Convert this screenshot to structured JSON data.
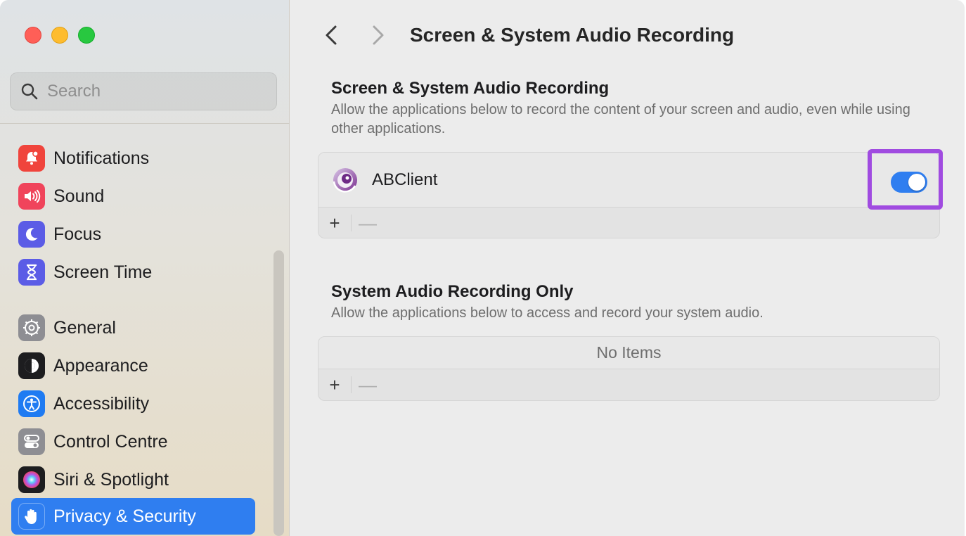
{
  "window": {
    "title": "Screen & System Audio Recording"
  },
  "sidebar": {
    "search_placeholder": "Search",
    "items": [
      {
        "label": "Notifications",
        "icon": "bell-icon",
        "color": "#f0443c"
      },
      {
        "label": "Sound",
        "icon": "speaker-icon",
        "color": "#f0445b"
      },
      {
        "label": "Focus",
        "icon": "moon-icon",
        "color": "#5b5ce6"
      },
      {
        "label": "Screen Time",
        "icon": "hourglass-icon",
        "color": "#5b5ce6"
      },
      {
        "label": "General",
        "icon": "gear-icon",
        "color": "#8e8e93"
      },
      {
        "label": "Appearance",
        "icon": "appearance-icon",
        "color": "#1d1d1f"
      },
      {
        "label": "Accessibility",
        "icon": "accessibility-icon",
        "color": "#1f7bf2"
      },
      {
        "label": "Control Centre",
        "icon": "toggles-icon",
        "color": "#8e8e93"
      },
      {
        "label": "Siri & Spotlight",
        "icon": "siri-icon",
        "color": "#1d1d1f"
      },
      {
        "label": "Privacy & Security",
        "icon": "hand-icon",
        "color": "#2f7ef0",
        "active": true
      }
    ]
  },
  "main": {
    "nav": {
      "back": "chevron-left-icon",
      "forward": "chevron-right-icon"
    },
    "section1": {
      "title": "Screen & System Audio Recording",
      "description": "Allow the applications below to record the content of your screen and audio, even while using other applications.",
      "apps": [
        {
          "name": "ABClient",
          "enabled": true
        }
      ],
      "add_label": "+",
      "remove_label": "—"
    },
    "section2": {
      "title": "System Audio Recording Only",
      "description": "Allow the applications below to access and record your system audio.",
      "empty_label": "No Items",
      "add_label": "+",
      "remove_label": "—"
    }
  },
  "colors": {
    "accent": "#2f7ef0",
    "highlight": "#a04be0"
  }
}
